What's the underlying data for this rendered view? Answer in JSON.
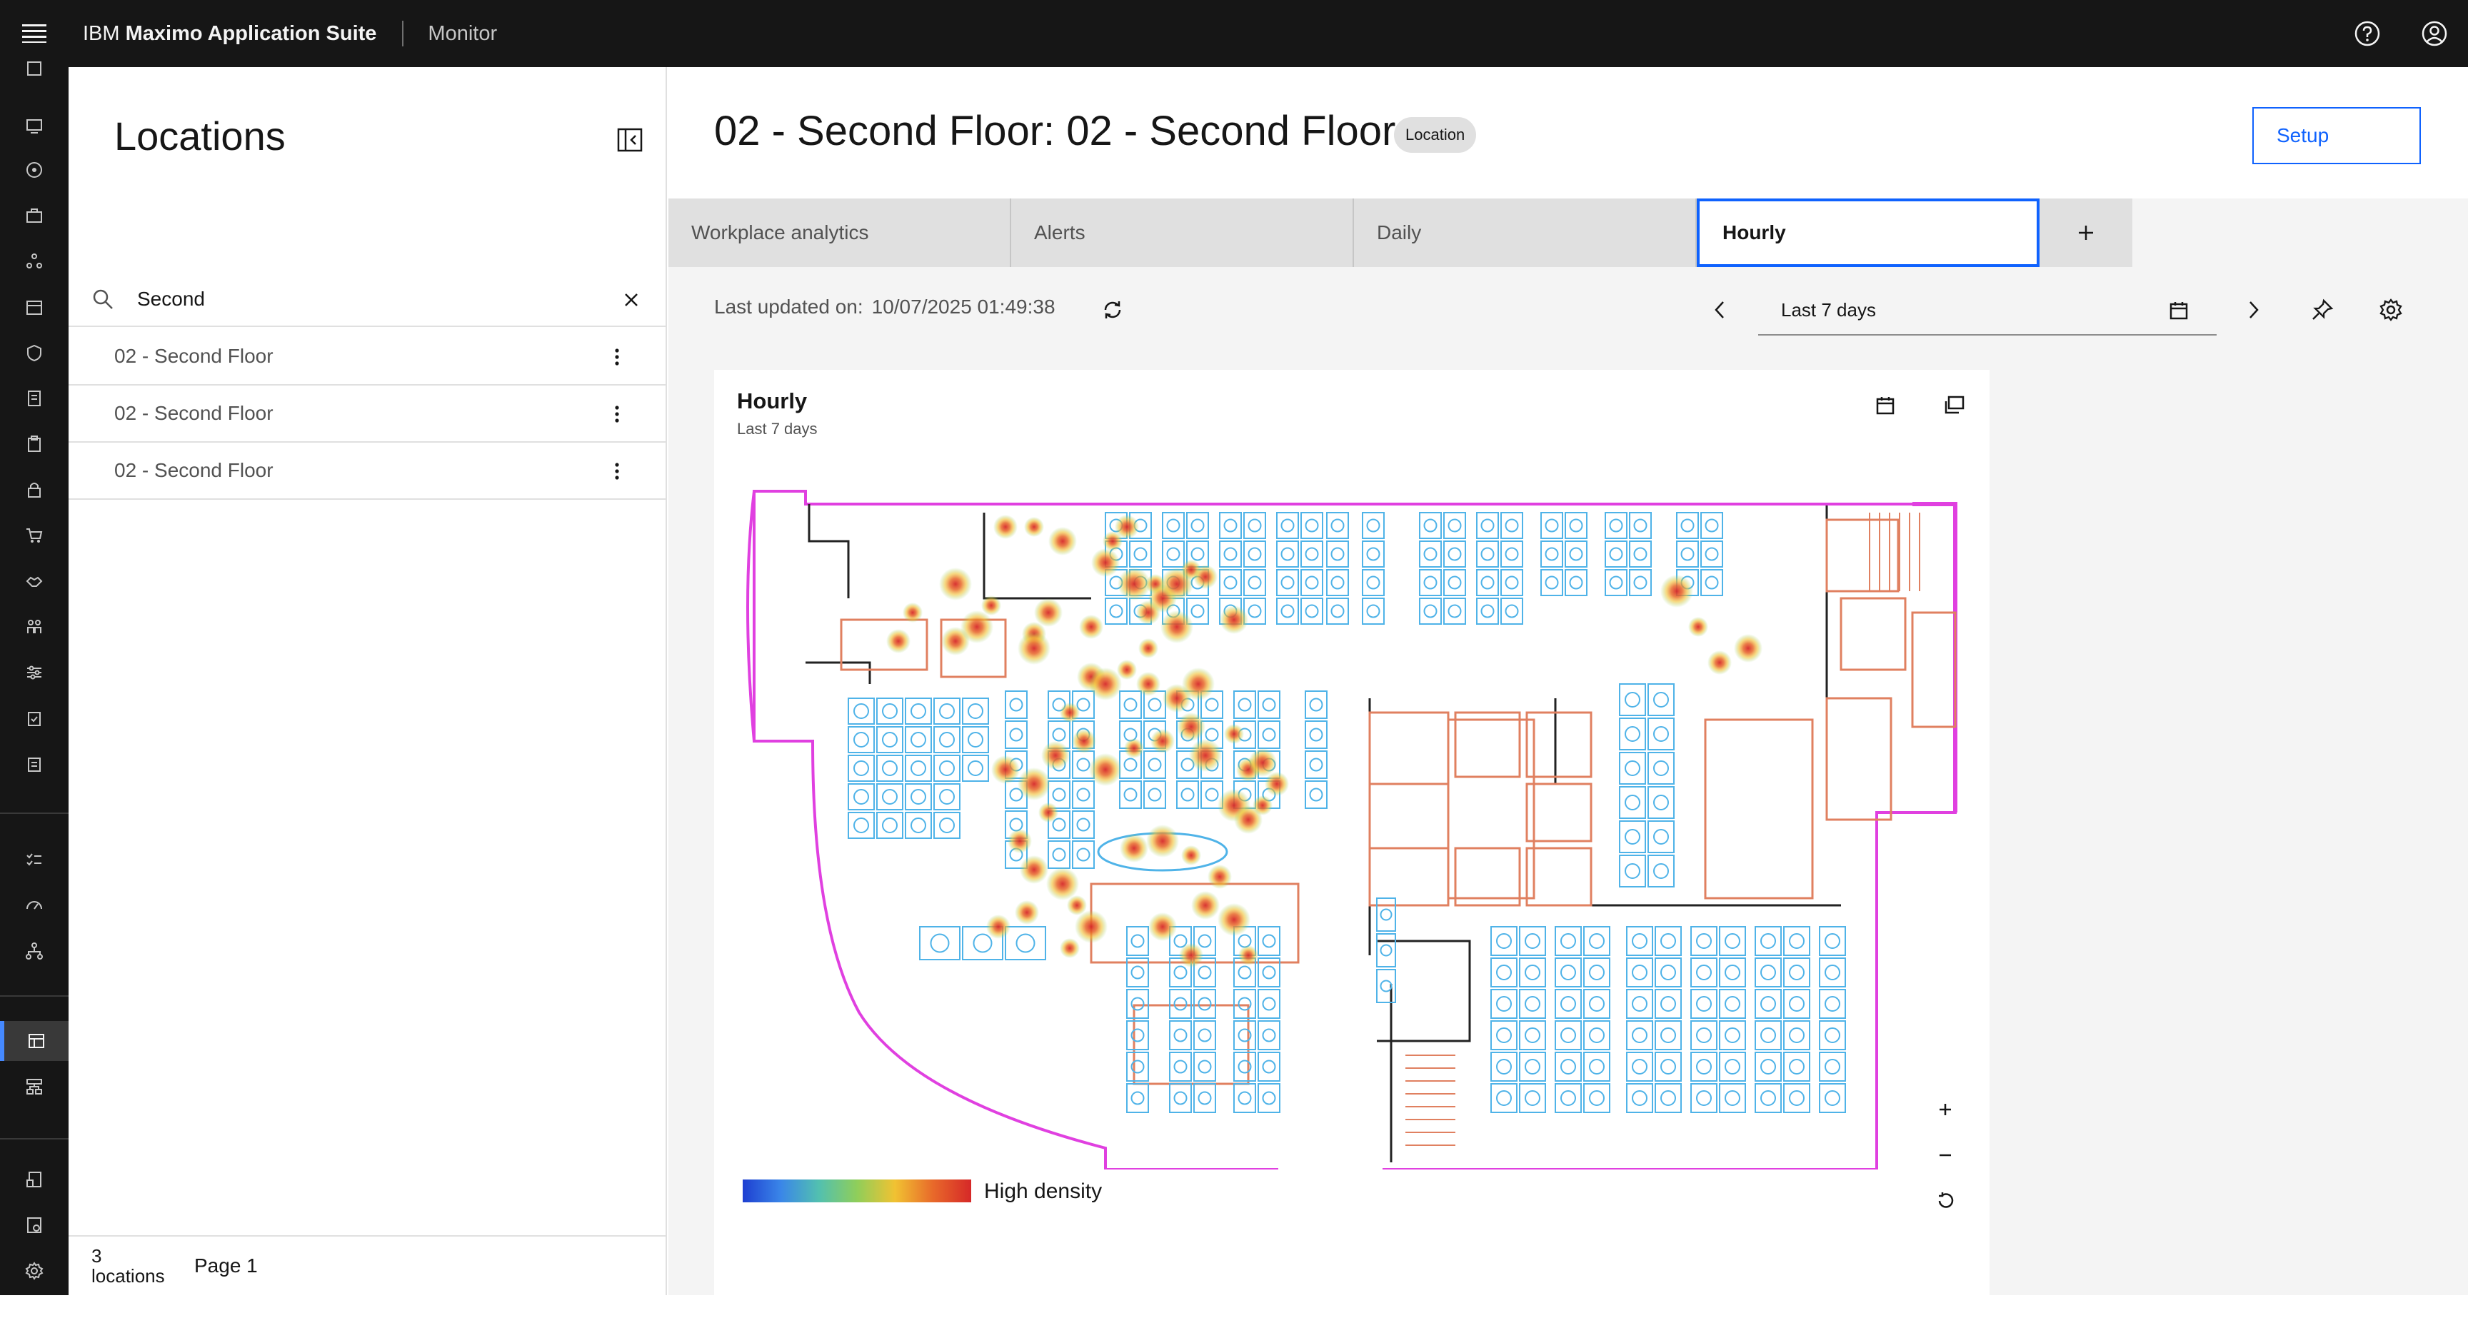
{
  "header": {
    "brand_prefix": "IBM",
    "brand_name": "Maximo Application Suite",
    "app_name": "Monitor",
    "help_icon": "help-icon",
    "user_icon": "user-avatar-icon"
  },
  "rail": {
    "active_item": "heatmap-dashboard",
    "icons": [
      "analytics-icon",
      "monitor-icon",
      "asset-icon",
      "briefcase-icon",
      "network-icon",
      "calendar-icon",
      "shield-icon",
      "report-icon",
      "clipboard-icon",
      "lock-icon",
      "cart-icon",
      "handshake-icon",
      "people-icon",
      "sliders-icon",
      "checklist-icon",
      "clipboard-2-icon",
      "tasks-icon",
      "gauge-icon",
      "hierarchy-icon",
      "dashboard-icon",
      "flow-icon",
      "device-icon",
      "tablet-icon",
      "settings-icon"
    ]
  },
  "locations": {
    "title": "Locations",
    "search_value": "Second",
    "items": [
      {
        "label": "02 - Second Floor"
      },
      {
        "label": "02 - Second Floor"
      },
      {
        "label": "02 - Second Floor"
      }
    ],
    "count_text": "3\nlocations",
    "page_text": "Page 1"
  },
  "main": {
    "title": "02 - Second Floor: 02 - Second Floor",
    "tag": "Location",
    "setup_label": "Setup",
    "tabs": [
      {
        "label": "Workplace analytics",
        "selected": false
      },
      {
        "label": "Alerts",
        "selected": false
      },
      {
        "label": "Daily",
        "selected": false
      },
      {
        "label": "Hourly",
        "selected": true
      }
    ],
    "last_updated_label": "Last updated on:",
    "last_updated_value": "10/07/2025 01:49:38",
    "date_range": "Last 7 days"
  },
  "card": {
    "title": "Hourly",
    "subtitle": "Last 7 days",
    "legend_label": "High density",
    "colors": {
      "wall": "#e040e0",
      "desk": "#4fb3e8",
      "room": "#e08060",
      "heat": "#d62828"
    }
  }
}
